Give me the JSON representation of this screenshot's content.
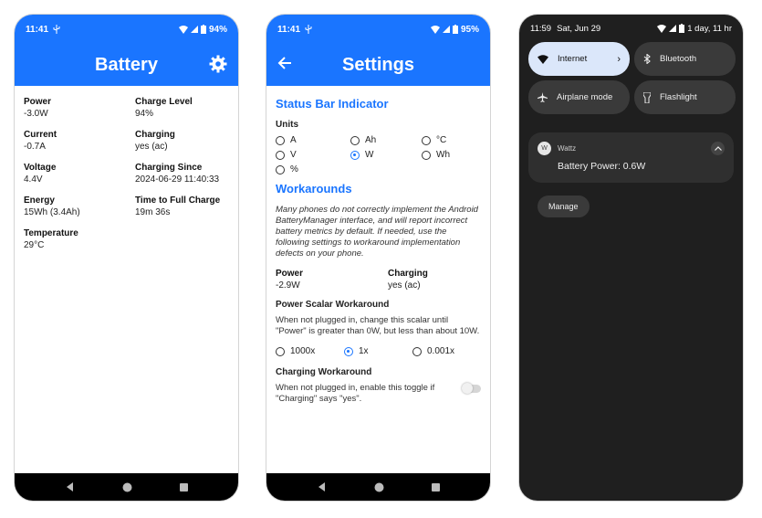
{
  "phone1": {
    "time": "11:41",
    "battery_pct": "94%",
    "title": "Battery",
    "stats": [
      {
        "label": "Power",
        "value": "-3.0W"
      },
      {
        "label": "Charge Level",
        "value": "94%"
      },
      {
        "label": "Current",
        "value": "-0.7A"
      },
      {
        "label": "Charging",
        "value": "yes (ac)"
      },
      {
        "label": "Voltage",
        "value": "4.4V"
      },
      {
        "label": "Charging Since",
        "value": "2024-06-29 11:40:33"
      },
      {
        "label": "Energy",
        "value": "15Wh (3.4Ah)"
      },
      {
        "label": "Time to Full Charge",
        "value": "19m 36s"
      },
      {
        "label": "Temperature",
        "value": "29°C"
      }
    ]
  },
  "phone2": {
    "time": "11:41",
    "battery_pct": "95%",
    "title": "Settings",
    "status_bar_section": "Status Bar Indicator",
    "units_label": "Units",
    "units": [
      {
        "label": "A",
        "selected": false
      },
      {
        "label": "Ah",
        "selected": false
      },
      {
        "label": "°C",
        "selected": false
      },
      {
        "label": "V",
        "selected": false
      },
      {
        "label": "W",
        "selected": true
      },
      {
        "label": "Wh",
        "selected": false
      },
      {
        "label": "%",
        "selected": false
      }
    ],
    "workarounds_section": "Workarounds",
    "workarounds_desc": "Many phones do not correctly implement the Android BatteryManager interface, and will report incorrect battery metrics by default. If needed, use the following settings to workaround implementation defects on your phone.",
    "power_label": "Power",
    "power_value": "-2.9W",
    "charging_label": "Charging",
    "charging_value": "yes (ac)",
    "scalar_label": "Power Scalar Workaround",
    "scalar_desc": "When not plugged in, change this scalar until \"Power\" is greater than 0W, but less than about 10W.",
    "scalars": [
      {
        "label": "1000x",
        "selected": false
      },
      {
        "label": "1x",
        "selected": true
      },
      {
        "label": "0.001x",
        "selected": false
      }
    ],
    "charging_wa_label": "Charging Workaround",
    "charging_wa_desc": "When not plugged in, enable this toggle if \"Charging\" says \"yes\".",
    "charging_wa_enabled": false
  },
  "phone3": {
    "time": "11:59",
    "date": "Sat, Jun 29",
    "battery_text": "1 day, 11 hr",
    "tiles": [
      {
        "label": "Internet",
        "icon": "wifi-icon",
        "on": true
      },
      {
        "label": "Bluetooth",
        "icon": "bluetooth-icon",
        "on": false
      },
      {
        "label": "Airplane mode",
        "icon": "airplane-icon",
        "on": false
      },
      {
        "label": "Flashlight",
        "icon": "flashlight-icon",
        "on": false
      }
    ],
    "notif_app": "Wattz",
    "notif_text": "Battery Power: 0.6W",
    "manage_label": "Manage"
  },
  "colors": {
    "accent": "#1a75ff",
    "dark_bg": "#1f1f1f"
  }
}
